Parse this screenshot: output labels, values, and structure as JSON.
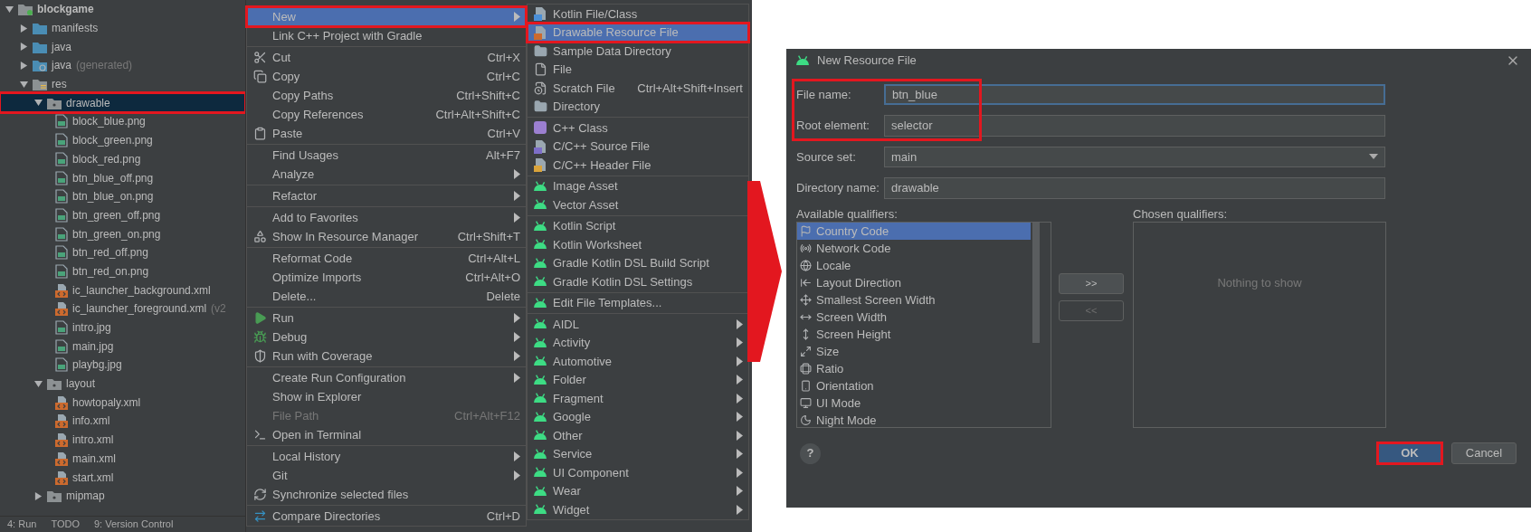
{
  "project_tree": {
    "items": [
      {
        "label": "blockgame",
        "kind": "module",
        "expanded": true,
        "selected": false,
        "highlighted": false,
        "children": [
          {
            "label": "manifests",
            "kind": "folder",
            "expanded": false,
            "selected": false,
            "highlighted": false
          },
          {
            "label": "java",
            "kind": "folder",
            "expanded": false,
            "selected": false,
            "highlighted": false
          },
          {
            "label": "java",
            "suffix": "(generated)",
            "kind": "generated-folder",
            "expanded": false,
            "selected": false,
            "highlighted": false
          },
          {
            "label": "res",
            "kind": "resources",
            "expanded": true,
            "selected": false,
            "highlighted": false,
            "children": [
              {
                "label": "drawable",
                "kind": "package",
                "expanded": true,
                "selected": true,
                "highlighted": true,
                "children": [
                  {
                    "label": "block_blue.png",
                    "kind": "image",
                    "selected": false,
                    "highlighted": false
                  },
                  {
                    "label": "block_green.png",
                    "kind": "image",
                    "selected": false,
                    "highlighted": false
                  },
                  {
                    "label": "block_red.png",
                    "kind": "image",
                    "selected": false,
                    "highlighted": false
                  },
                  {
                    "label": "btn_blue_off.png",
                    "kind": "image",
                    "selected": false,
                    "highlighted": false
                  },
                  {
                    "label": "btn_blue_on.png",
                    "kind": "image",
                    "selected": false,
                    "highlighted": false
                  },
                  {
                    "label": "btn_green_off.png",
                    "kind": "image",
                    "selected": false,
                    "highlighted": false
                  },
                  {
                    "label": "btn_green_on.png",
                    "kind": "image",
                    "selected": false,
                    "highlighted": false
                  },
                  {
                    "label": "btn_red_off.png",
                    "kind": "image",
                    "selected": false,
                    "highlighted": false
                  },
                  {
                    "label": "btn_red_on.png",
                    "kind": "image",
                    "selected": false,
                    "highlighted": false
                  },
                  {
                    "label": "ic_launcher_background.xml",
                    "kind": "xml",
                    "selected": false,
                    "highlighted": false
                  },
                  {
                    "label": "ic_launcher_foreground.xml",
                    "suffix": "(v2",
                    "kind": "xml",
                    "selected": false,
                    "highlighted": false
                  },
                  {
                    "label": "intro.jpg",
                    "kind": "image",
                    "selected": false,
                    "highlighted": false
                  },
                  {
                    "label": "main.jpg",
                    "kind": "image",
                    "selected": false,
                    "highlighted": false
                  },
                  {
                    "label": "playbg.jpg",
                    "kind": "image",
                    "selected": false,
                    "highlighted": false
                  }
                ]
              },
              {
                "label": "layout",
                "kind": "package",
                "expanded": true,
                "selected": false,
                "highlighted": false,
                "children": [
                  {
                    "label": "howtopaly.xml",
                    "kind": "xml",
                    "selected": false,
                    "highlighted": false
                  },
                  {
                    "label": "info.xml",
                    "kind": "xml",
                    "selected": false,
                    "highlighted": false
                  },
                  {
                    "label": "intro.xml",
                    "kind": "xml",
                    "selected": false,
                    "highlighted": false
                  },
                  {
                    "label": "main.xml",
                    "kind": "xml",
                    "selected": false,
                    "highlighted": false
                  },
                  {
                    "label": "start.xml",
                    "kind": "xml",
                    "selected": false,
                    "highlighted": false
                  }
                ]
              },
              {
                "label": "mipmap",
                "kind": "package",
                "expanded": false,
                "selected": false,
                "highlighted": false
              }
            ]
          }
        ]
      }
    ]
  },
  "tool_windows": [
    "4: Run",
    "TODO",
    "9: Version Control"
  ],
  "context_menu": {
    "groups": [
      [
        {
          "label": "New",
          "submenu": true,
          "disabled": false,
          "selected": true,
          "highlighted": true
        },
        {
          "label": "Link C++ Project with Gradle",
          "submenu": false,
          "disabled": false,
          "selected": false,
          "highlighted": false
        }
      ],
      [
        {
          "label": "Cut",
          "shortcut": "Ctrl+X",
          "submenu": false,
          "disabled": false,
          "selected": false,
          "highlighted": false
        },
        {
          "label": "Copy",
          "shortcut": "Ctrl+C",
          "submenu": false,
          "disabled": false,
          "selected": false,
          "highlighted": false
        },
        {
          "label": "Copy Paths",
          "shortcut": "Ctrl+Shift+C",
          "submenu": false,
          "disabled": false,
          "selected": false,
          "highlighted": false
        },
        {
          "label": "Copy References",
          "shortcut": "Ctrl+Alt+Shift+C",
          "submenu": false,
          "disabled": false,
          "selected": false,
          "highlighted": false
        },
        {
          "label": "Paste",
          "shortcut": "Ctrl+V",
          "submenu": false,
          "disabled": false,
          "selected": false,
          "highlighted": false
        }
      ],
      [
        {
          "label": "Find Usages",
          "shortcut": "Alt+F7",
          "submenu": false,
          "disabled": false,
          "selected": false,
          "highlighted": false
        },
        {
          "label": "Analyze",
          "submenu": true,
          "disabled": false,
          "selected": false,
          "highlighted": false
        }
      ],
      [
        {
          "label": "Refactor",
          "submenu": true,
          "disabled": false,
          "selected": false,
          "highlighted": false
        }
      ],
      [
        {
          "label": "Add to Favorites",
          "submenu": true,
          "disabled": false,
          "selected": false,
          "highlighted": false
        },
        {
          "label": "Show In Resource Manager",
          "shortcut": "Ctrl+Shift+T",
          "submenu": false,
          "disabled": false,
          "selected": false,
          "highlighted": false
        }
      ],
      [
        {
          "label": "Reformat Code",
          "shortcut": "Ctrl+Alt+L",
          "submenu": false,
          "disabled": false,
          "selected": false,
          "highlighted": false
        },
        {
          "label": "Optimize Imports",
          "shortcut": "Ctrl+Alt+O",
          "submenu": false,
          "disabled": false,
          "selected": false,
          "highlighted": false
        },
        {
          "label": "Delete...",
          "shortcut": "Delete",
          "submenu": false,
          "disabled": false,
          "selected": false,
          "highlighted": false
        }
      ],
      [
        {
          "label": "Run",
          "submenu": true,
          "disabled": false,
          "selected": false,
          "highlighted": false
        },
        {
          "label": "Debug",
          "submenu": true,
          "disabled": false,
          "selected": false,
          "highlighted": false
        },
        {
          "label": "Run with Coverage",
          "submenu": true,
          "disabled": false,
          "selected": false,
          "highlighted": false
        }
      ],
      [
        {
          "label": "Create Run Configuration",
          "submenu": true,
          "disabled": false,
          "selected": false,
          "highlighted": false
        },
        {
          "label": "Show in Explorer",
          "submenu": false,
          "disabled": false,
          "selected": false,
          "highlighted": false
        },
        {
          "label": "File Path",
          "shortcut": "Ctrl+Alt+F12",
          "submenu": false,
          "disabled": true,
          "selected": false,
          "highlighted": false
        },
        {
          "label": "Open in Terminal",
          "submenu": false,
          "disabled": false,
          "selected": false,
          "highlighted": false
        }
      ],
      [
        {
          "label": "Local History",
          "submenu": true,
          "disabled": false,
          "selected": false,
          "highlighted": false
        },
        {
          "label": "Git",
          "submenu": true,
          "disabled": false,
          "selected": false,
          "highlighted": false
        },
        {
          "label": "Synchronize selected files",
          "submenu": false,
          "disabled": false,
          "selected": false,
          "highlighted": false
        }
      ],
      [
        {
          "label": "Compare Directories",
          "shortcut": "Ctrl+D",
          "submenu": false,
          "disabled": false,
          "selected": false,
          "highlighted": false
        }
      ]
    ]
  },
  "new_submenu": {
    "groups": [
      [
        {
          "label": "Kotlin File/Class",
          "submenu": false,
          "disabled": false,
          "selected": false,
          "highlighted": false
        },
        {
          "label": "Drawable Resource File",
          "submenu": false,
          "disabled": false,
          "selected": true,
          "highlighted": true
        },
        {
          "label": "Sample Data Directory",
          "submenu": false,
          "disabled": false,
          "selected": false,
          "highlighted": false
        },
        {
          "label": "File",
          "submenu": false,
          "disabled": false,
          "selected": false,
          "highlighted": false
        },
        {
          "label": "Scratch File",
          "shortcut": "Ctrl+Alt+Shift+Insert",
          "submenu": false,
          "disabled": false,
          "selected": false,
          "highlighted": false
        },
        {
          "label": "Directory",
          "submenu": false,
          "disabled": false,
          "selected": false,
          "highlighted": false
        }
      ],
      [
        {
          "label": "C++ Class",
          "submenu": false,
          "disabled": false,
          "selected": false,
          "highlighted": false
        },
        {
          "label": "C/C++ Source File",
          "submenu": false,
          "disabled": false,
          "selected": false,
          "highlighted": false
        },
        {
          "label": "C/C++ Header File",
          "submenu": false,
          "disabled": false,
          "selected": false,
          "highlighted": false
        }
      ],
      [
        {
          "label": "Image Asset",
          "submenu": false,
          "disabled": false,
          "selected": false,
          "highlighted": false
        },
        {
          "label": "Vector Asset",
          "submenu": false,
          "disabled": false,
          "selected": false,
          "highlighted": false
        }
      ],
      [
        {
          "label": "Kotlin Script",
          "submenu": false,
          "disabled": false,
          "selected": false,
          "highlighted": false
        },
        {
          "label": "Kotlin Worksheet",
          "submenu": false,
          "disabled": false,
          "selected": false,
          "highlighted": false
        },
        {
          "label": "Gradle Kotlin DSL Build Script",
          "submenu": false,
          "disabled": false,
          "selected": false,
          "highlighted": false
        },
        {
          "label": "Gradle Kotlin DSL Settings",
          "submenu": false,
          "disabled": false,
          "selected": false,
          "highlighted": false
        }
      ],
      [
        {
          "label": "Edit File Templates...",
          "submenu": false,
          "disabled": false,
          "selected": false,
          "highlighted": false
        }
      ],
      [
        {
          "label": "AIDL",
          "submenu": true,
          "disabled": false,
          "selected": false,
          "highlighted": false
        },
        {
          "label": "Activity",
          "submenu": true,
          "disabled": false,
          "selected": false,
          "highlighted": false
        },
        {
          "label": "Automotive",
          "submenu": true,
          "disabled": false,
          "selected": false,
          "highlighted": false
        },
        {
          "label": "Folder",
          "submenu": true,
          "disabled": false,
          "selected": false,
          "highlighted": false
        },
        {
          "label": "Fragment",
          "submenu": true,
          "disabled": false,
          "selected": false,
          "highlighted": false
        },
        {
          "label": "Google",
          "submenu": true,
          "disabled": false,
          "selected": false,
          "highlighted": false
        },
        {
          "label": "Other",
          "submenu": true,
          "disabled": false,
          "selected": false,
          "highlighted": false
        },
        {
          "label": "Service",
          "submenu": true,
          "disabled": false,
          "selected": false,
          "highlighted": false
        },
        {
          "label": "UI Component",
          "submenu": true,
          "disabled": false,
          "selected": false,
          "highlighted": false
        },
        {
          "label": "Wear",
          "submenu": true,
          "disabled": false,
          "selected": false,
          "highlighted": false
        },
        {
          "label": "Widget",
          "submenu": true,
          "disabled": false,
          "selected": false,
          "highlighted": false
        }
      ]
    ]
  },
  "dialog": {
    "title": "New Resource File",
    "fields": [
      {
        "label": "File name:",
        "value": "btn_blue",
        "kind": "text",
        "focused": true,
        "highlighted": true
      },
      {
        "label": "Root element:",
        "value": "selector",
        "kind": "text",
        "focused": false,
        "highlighted": true
      },
      {
        "label": "Source set:",
        "value": "main",
        "kind": "dropdown",
        "focused": false,
        "highlighted": false
      },
      {
        "label": "Directory name:",
        "value": "drawable",
        "kind": "text",
        "focused": false,
        "highlighted": false
      }
    ],
    "available_qualifiers": {
      "label": "Available qualifiers:",
      "items": [
        {
          "label": "Country Code",
          "selected": true
        },
        {
          "label": "Network Code",
          "selected": false
        },
        {
          "label": "Locale",
          "selected": false
        },
        {
          "label": "Layout Direction",
          "selected": false
        },
        {
          "label": "Smallest Screen Width",
          "selected": false
        },
        {
          "label": "Screen Width",
          "selected": false
        },
        {
          "label": "Screen Height",
          "selected": false
        },
        {
          "label": "Size",
          "selected": false
        },
        {
          "label": "Ratio",
          "selected": false
        },
        {
          "label": "Orientation",
          "selected": false
        },
        {
          "label": "UI Mode",
          "selected": false
        },
        {
          "label": "Night Mode",
          "selected": false
        }
      ]
    },
    "move_buttons": [
      {
        "label": ">>",
        "disabled": false
      },
      {
        "label": "<<",
        "disabled": true
      }
    ],
    "chosen_qualifiers": {
      "label": "Chosen qualifiers:",
      "empty_text": "Nothing to show"
    },
    "help": "?",
    "buttons": [
      {
        "label": "OK",
        "default": true,
        "highlighted": true
      },
      {
        "label": "Cancel",
        "default": false,
        "highlighted": false
      }
    ]
  }
}
